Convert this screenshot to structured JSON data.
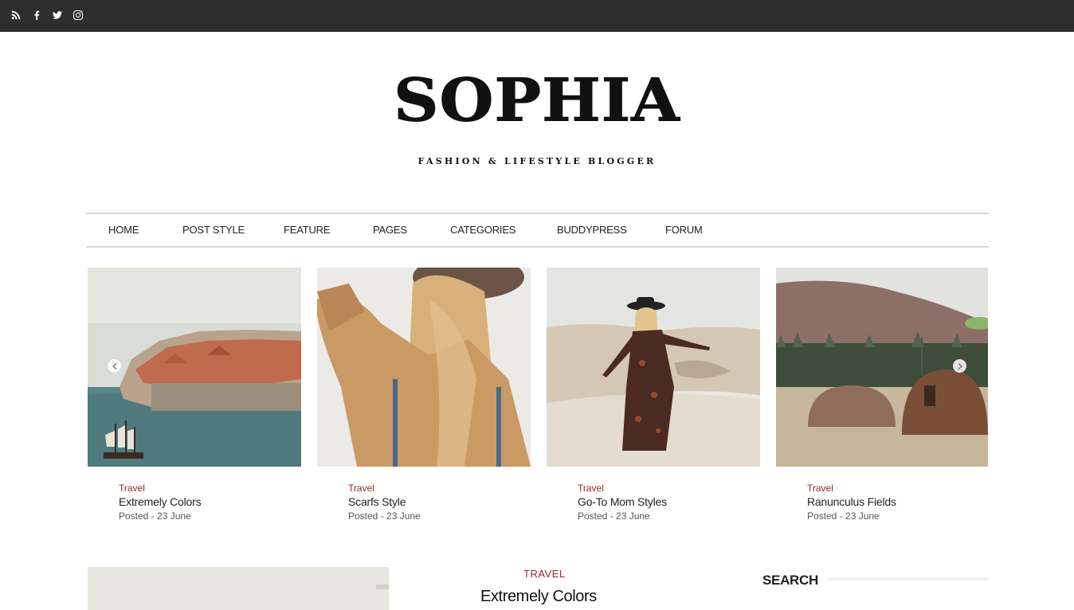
{
  "social": {
    "icons": [
      "rss-icon",
      "facebook-icon",
      "twitter-icon",
      "instagram-icon"
    ]
  },
  "brand": {
    "title": "SOPHIA",
    "tagline": "FASHION & LIFESTYLE BLOGGER"
  },
  "nav": {
    "items": [
      {
        "label": "HOME"
      },
      {
        "label": "POST STYLE"
      },
      {
        "label": "FEATURE"
      },
      {
        "label": "PAGES"
      },
      {
        "label": "CATEGORIES"
      },
      {
        "label": "BUDDYPRESS"
      },
      {
        "label": "FORUM"
      }
    ]
  },
  "carousel": {
    "cards": [
      {
        "category": "Travel",
        "title": "Extremely Colors",
        "posted": "Posted - 23 June"
      },
      {
        "category": "Travel",
        "title": "Scarfs Style",
        "posted": "Posted - 23 June"
      },
      {
        "category": "Travel",
        "title": "Go-To Mom Styles",
        "posted": "Posted - 23 June"
      },
      {
        "category": "Travel",
        "title": "Ranunculus Fields",
        "posted": "Posted - 23 June"
      }
    ]
  },
  "featured": {
    "category": "TRAVEL",
    "title": "Extremely Colors"
  },
  "sidebar": {
    "search_label": "SEARCH"
  },
  "colors": {
    "topbar": "#2e2e2e",
    "accent": "#8a2a2a"
  }
}
